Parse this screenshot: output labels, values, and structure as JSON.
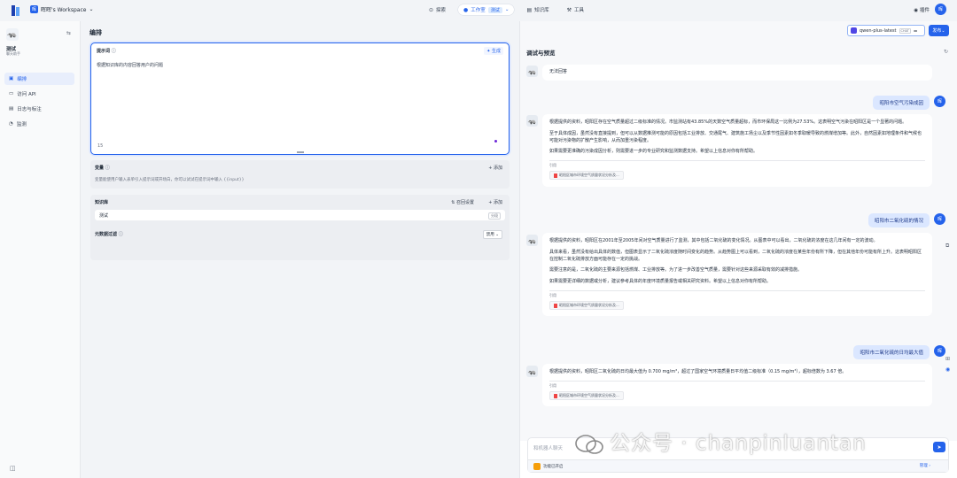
{
  "topbar": {
    "workspace_badge": "晖",
    "workspace": "晖晖's Workspace",
    "nav": [
      {
        "label": "探索"
      },
      {
        "label": "工作室",
        "chip": "测试"
      },
      {
        "label": "知识库"
      },
      {
        "label": "工具"
      }
    ],
    "plugin": "插件",
    "user_initial": "晖"
  },
  "sidebar": {
    "app_name": "测试",
    "app_sub": "聊天助手",
    "items": [
      {
        "label": "编排",
        "active": true
      },
      {
        "label": "访问 API"
      },
      {
        "label": "日志与标注"
      },
      {
        "label": "监测"
      }
    ]
  },
  "middle": {
    "title": "编排",
    "prompt": {
      "label": "提示词",
      "gen": "生成",
      "text": "根据知识库的内容回答用户的问题",
      "count": "15"
    },
    "vars": {
      "title": "变量",
      "add": "添加",
      "desc": "变量能使用户输入表单引入提示词或开场白，你可以试试在提示词中输入 {{input}}"
    },
    "kb": {
      "title": "知识库",
      "settings": "召回设置",
      "add": "添加",
      "item": "测试",
      "item_tag": "分段",
      "filter": "元数据过滤",
      "filter_value": "禁用"
    }
  },
  "right": {
    "title": "调试与预览",
    "model": "qwen-plus-latest",
    "model_tag": "CHAT",
    "publish": "发布",
    "messages": [
      {
        "role": "bot",
        "paras": [
          "无法回答"
        ]
      },
      {
        "role": "user",
        "text": "昭阳市空气污染成因"
      },
      {
        "role": "bot",
        "paras": [
          "根据提供的资料，昭阳区存在空气质量超过二级标准的情况。市监测站有43.85%的天数空气质量超标，而市环保局这一比例为27.53%。这表明空气污染在昭阳区是一个显著的问题。",
          "至于具体成因，虽然没有直接提到，但可以从数据推测可能的原因包括工业排放、交通尾气、建筑施工扬尘以及季节性因素如冬季取暖导致的燃煤增加等。此外，自然因素如地理条件和气候也可能对污染物的扩散产生影响，从而加重污染程度。",
          "如果需要更准确的污染成因分析，则需要进一步的专业研究和监测数据支持。希望以上信息对你有所帮助。"
        ],
        "cite": "引用",
        "chip": "昭阳区城市环境空气质量状况分析及..."
      },
      {
        "role": "user",
        "text": "昭阳市二氧化硫的情况"
      },
      {
        "role": "bot",
        "paras": [
          "根据提供的资料，昭阳区在2001年至2005年间对空气质量进行了监测，其中包括二氧化硫的变化情况。从图表中可以看出，二氧化硫的浓度在这几年间有一定的波动。",
          "具体来看，虽然没有给出具体的数值，但图表显示了二氧化硫浓度随时间变化的趋势。从趋势图上可以看到，二氧化硫的浓度在某些年份有所下降，但在其他年份可能有所上升。这表明昭阳区在控制二氧化硫排放方面可能存在一定的挑战。",
          "需要注意的是，二氧化硫的主要来源包括燃煤、工业排放等。为了进一步改善空气质量，需要针对这些来源采取有效的减排措施。",
          "如果需要更详细的数据或分析，建议参考具体的年度环境质量报告或相关研究资料。希望以上信息对你有所帮助。"
        ],
        "cite": "引用",
        "chip": "昭阳区城市环境空气质量状况分析及..."
      },
      {
        "role": "user",
        "text": "昭阳市二氧化硫的日均最大值"
      },
      {
        "role": "bot",
        "paras": [
          "根据提供的资料，昭阳区二氧化硫的日均最大值为 0.700 mg/m³，超过了国家空气环境质量日平均值二级标准（0.15 mg/m³），超标倍数为 3.67 倍。"
        ],
        "cite": "引用",
        "chip": "昭阳区城市环境空气质量状况分析及..."
      }
    ],
    "composer": {
      "placeholder": "和机器人聊天",
      "feature": "功能已开启",
      "manage": "管理"
    }
  },
  "watermark": "公众号 · chanpinluantan"
}
